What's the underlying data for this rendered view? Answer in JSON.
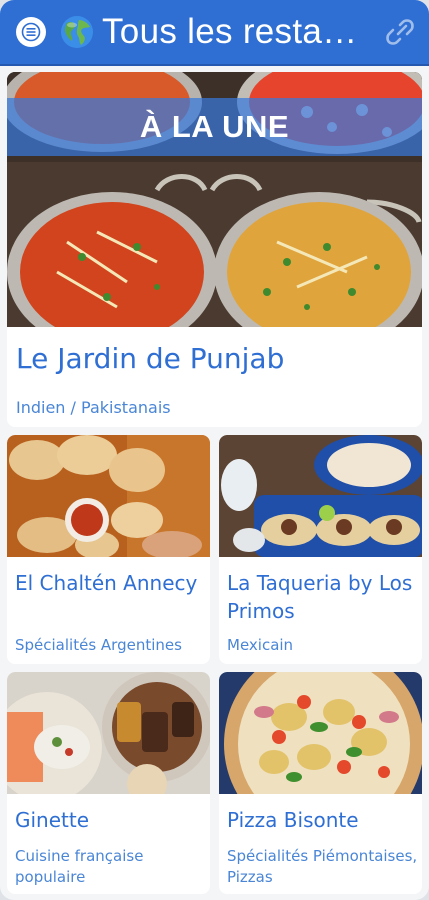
{
  "header": {
    "title": "Tous les restaurants",
    "menu_icon": "hamburger-menu-icon",
    "globe_icon": "globe-icon",
    "link_icon": "link-icon",
    "colors": {
      "bar": "#2f6fd3",
      "accent_text": "#2f6fd3"
    }
  },
  "featured": {
    "banner": "À LA UNE",
    "name": "Le Jardin de Punjab",
    "type": "Indien / Pakistanais",
    "image": "indian-curries-photo"
  },
  "restaurants": [
    {
      "name": "El Chaltén Annecy",
      "type": "Spécialités Argentines",
      "image": "empanadas-photo"
    },
    {
      "name": "La Taqueria by Los Primos",
      "type": "Mexicain",
      "image": "tacos-photo"
    },
    {
      "name": "Ginette",
      "type": "Cuisine française populaire",
      "image": "french-dishes-photo"
    },
    {
      "name": "Pizza Bisonte",
      "type": "Spécialités Piémontaises, Pizzas",
      "image": "pizza-photo"
    }
  ]
}
